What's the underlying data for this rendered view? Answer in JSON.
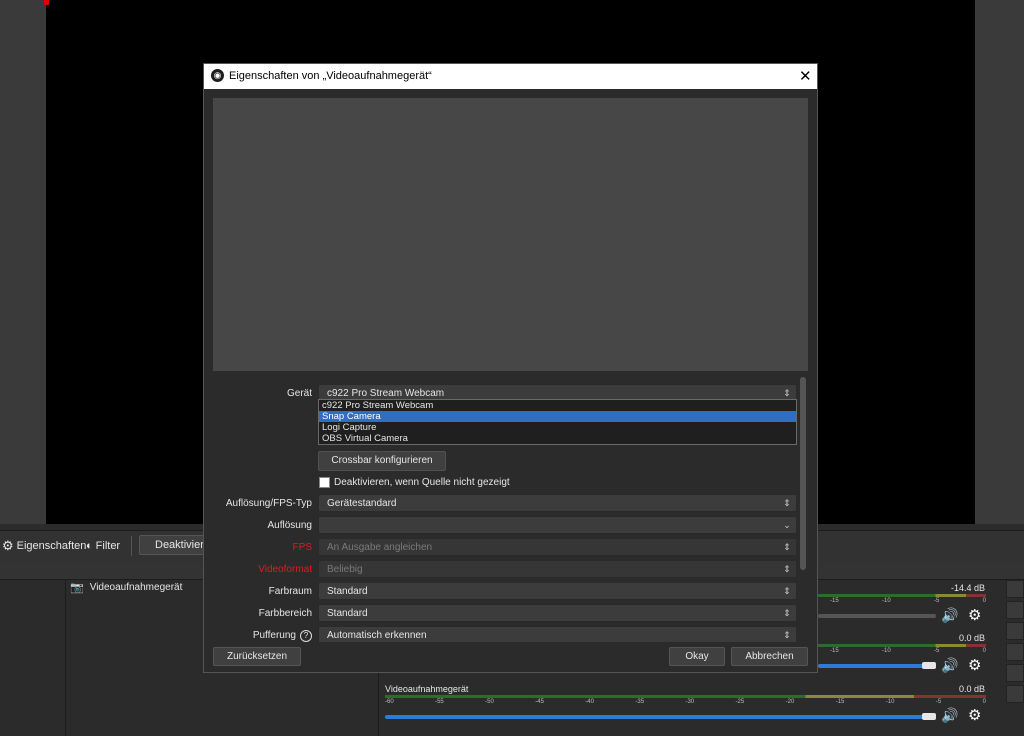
{
  "toolbar": {
    "properties_label": "Eigenschaften",
    "filter_label": "Filter",
    "deactivate_label": "Deaktivieren"
  },
  "sources": {
    "items": [
      {
        "name": "Videoaufnahmegerät"
      }
    ]
  },
  "mixer": {
    "channels": [
      {
        "name": "",
        "db": "-14.4 dB",
        "volume": 0.98
      },
      {
        "name": "",
        "db": "0.0 dB",
        "volume": 1.0
      },
      {
        "name": "Videoaufnahmegerät",
        "db": "0.0 dB",
        "volume": 1.0
      }
    ],
    "scale_full": [
      "-60",
      "-55",
      "-50",
      "-45",
      "-40",
      "-35",
      "-30",
      "-25",
      "-20",
      "-15",
      "-10",
      "-5",
      "0"
    ],
    "scale_partial": [
      "-15",
      "-10",
      "-5",
      "0"
    ]
  },
  "dialog": {
    "title": "Eigenschaften von „Videoaufnahmegerät“",
    "device_label": "Gerät",
    "device_value": "c922 Pro Stream Webcam",
    "device_options": [
      {
        "label": "c922 Pro Stream Webcam",
        "selected": false
      },
      {
        "label": "Snap Camera",
        "selected": true
      },
      {
        "label": "Logi Capture",
        "selected": false
      },
      {
        "label": "OBS Virtual Camera",
        "selected": false
      }
    ],
    "crossbar_button": "Crossbar konfigurieren",
    "deactivate_checkbox_label": "Deaktivieren, wenn Quelle nicht gezeigt",
    "deactivate_checked": false,
    "resolution_fps_type_label": "Auflösung/FPS-Typ",
    "resolution_fps_type_value": "Gerätestandard",
    "resolution_label": "Auflösung",
    "resolution_value": "",
    "fps_label": "FPS",
    "fps_value": "An Ausgabe angleichen",
    "videoformat_label": "Videoformat",
    "videoformat_value": "Beliebig",
    "colorspace_label": "Farbraum",
    "colorspace_value": "Standard",
    "colorrange_label": "Farbbereich",
    "colorrange_value": "Standard",
    "buffering_label": "Pufferung",
    "buffering_value": "Automatisch erkennen",
    "reset_button": "Zurücksetzen",
    "ok_button": "Okay",
    "cancel_button": "Abbrechen"
  },
  "colors": {
    "accent": "#2d6fc2",
    "error_label": "#e01b1b",
    "preview_bg": "#000000",
    "dialog_bg": "#2b2b2b"
  }
}
